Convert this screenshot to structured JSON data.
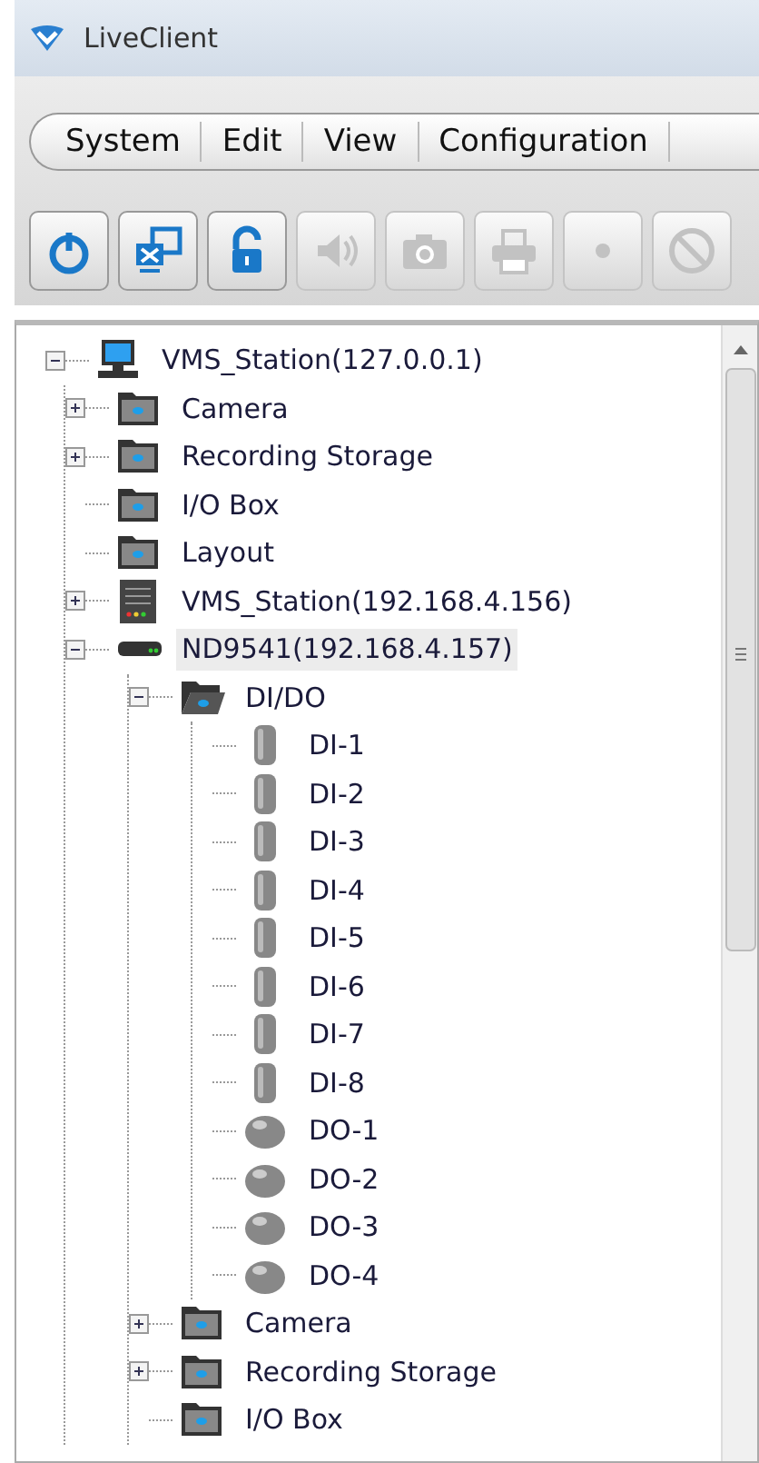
{
  "window": {
    "title": "LiveClient"
  },
  "menu": [
    {
      "label": "System"
    },
    {
      "label": "Edit"
    },
    {
      "label": "View"
    },
    {
      "label": "Configuration"
    }
  ],
  "toolbar": [
    {
      "kind": "power",
      "disabled": false
    },
    {
      "kind": "network",
      "disabled": false
    },
    {
      "kind": "lock",
      "disabled": false
    },
    {
      "kind": "speaker",
      "disabled": true
    },
    {
      "kind": "camera",
      "disabled": true
    },
    {
      "kind": "printer",
      "disabled": true
    },
    {
      "kind": "dot",
      "disabled": true
    },
    {
      "kind": "forbidden",
      "disabled": true
    }
  ],
  "tree": [
    {
      "label": "VMS_Station(127.0.0.1)",
      "kind": "computer",
      "expanded": true,
      "selected": false,
      "children": [
        {
          "label": "Camera",
          "kind": "folder",
          "expanded": false,
          "selected": false
        },
        {
          "label": "Recording Storage",
          "kind": "folder",
          "expanded": false,
          "selected": false
        },
        {
          "label": "I/O Box",
          "kind": "folder",
          "selected": false
        },
        {
          "label": "Layout",
          "kind": "folder",
          "selected": false
        },
        {
          "label": "VMS_Station(192.168.4.156)",
          "kind": "server",
          "expanded": false,
          "selected": false
        },
        {
          "label": "ND9541(192.168.4.157)",
          "kind": "nvr",
          "expanded": true,
          "selected": true,
          "children": [
            {
              "label": "DI/DO",
              "kind": "folder-open",
              "expanded": true,
              "selected": false,
              "children": [
                {
                  "label": "DI-1",
                  "kind": "di",
                  "selected": false
                },
                {
                  "label": "DI-2",
                  "kind": "di",
                  "selected": false
                },
                {
                  "label": "DI-3",
                  "kind": "di",
                  "selected": false
                },
                {
                  "label": "DI-4",
                  "kind": "di",
                  "selected": false
                },
                {
                  "label": "DI-5",
                  "kind": "di",
                  "selected": false
                },
                {
                  "label": "DI-6",
                  "kind": "di",
                  "selected": false
                },
                {
                  "label": "DI-7",
                  "kind": "di",
                  "selected": false
                },
                {
                  "label": "DI-8",
                  "kind": "di",
                  "selected": false
                },
                {
                  "label": "DO-1",
                  "kind": "do",
                  "selected": false
                },
                {
                  "label": "DO-2",
                  "kind": "do",
                  "selected": false
                },
                {
                  "label": "DO-3",
                  "kind": "do",
                  "selected": false
                },
                {
                  "label": "DO-4",
                  "kind": "do",
                  "selected": false
                }
              ]
            },
            {
              "label": "Camera",
              "kind": "folder",
              "expanded": false,
              "selected": false
            },
            {
              "label": "Recording Storage",
              "kind": "folder",
              "expanded": false,
              "selected": false
            },
            {
              "label": "I/O Box",
              "kind": "folder",
              "selected": false
            }
          ]
        }
      ]
    }
  ]
}
